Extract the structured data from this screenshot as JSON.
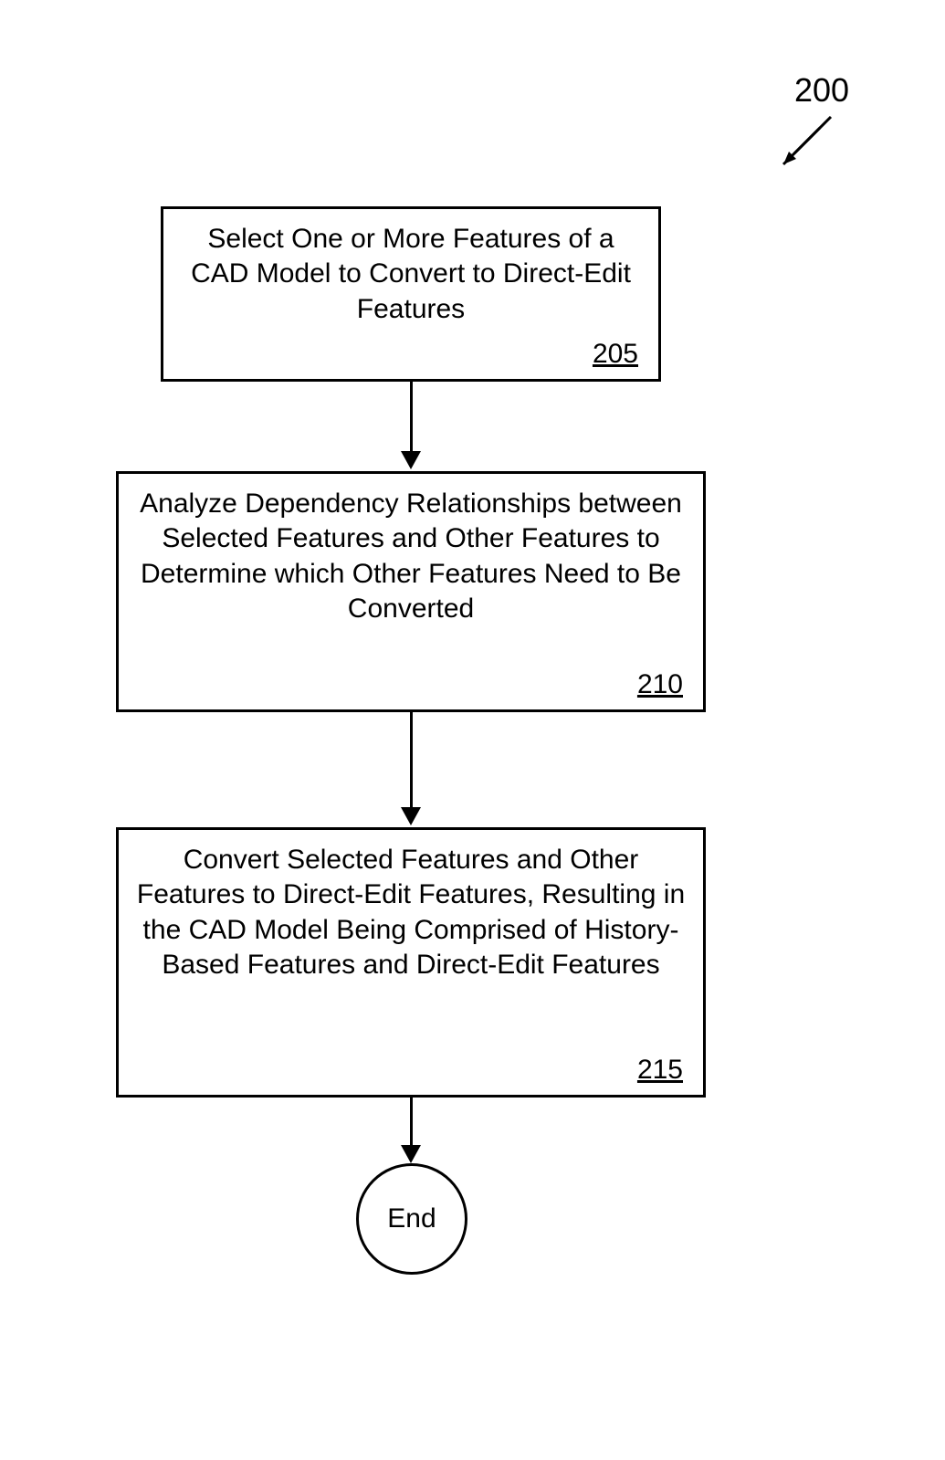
{
  "figure": {
    "label": "200",
    "end_label": "End",
    "steps": [
      {
        "text": "Select One or More Features of a CAD Model to Convert to Direct-Edit Features",
        "ref": "205"
      },
      {
        "text": "Analyze Dependency Relationships between Selected Features and Other Features to Determine which Other Features Need to Be Converted",
        "ref": "210"
      },
      {
        "text": "Convert Selected Features and Other Features to Direct-Edit Features, Resulting in the CAD Model Being Comprised of History-Based Features and Direct-Edit Features",
        "ref": "215"
      }
    ]
  }
}
